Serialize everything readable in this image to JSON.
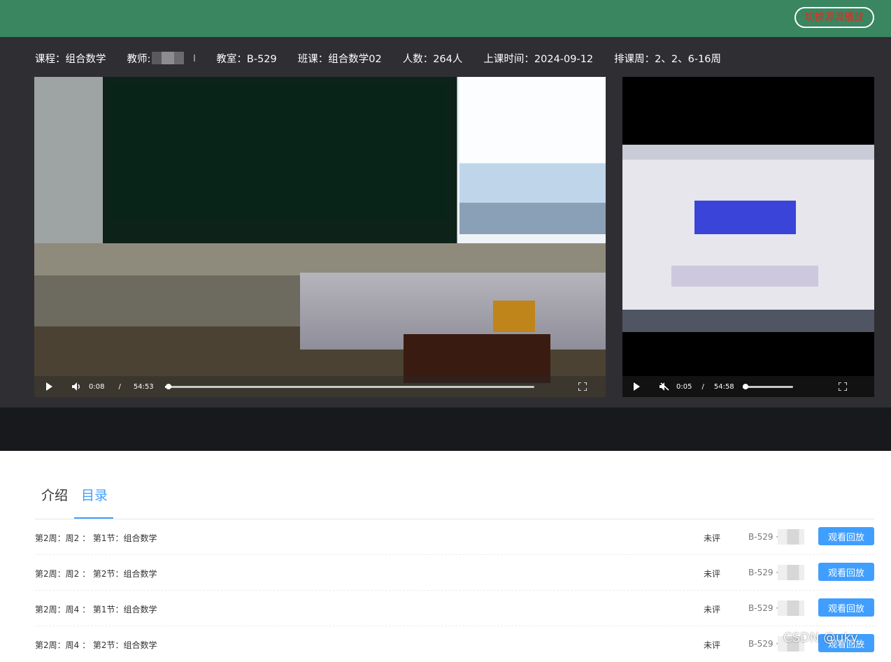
{
  "header": {
    "switch_button_label": "切换源流播放",
    "accent_color": "#3a8660"
  },
  "course_info": {
    "course": "课程：组合数学",
    "teacher_label": "教师:",
    "classroom": "教室：B-529",
    "class": "班课：组合数学02",
    "count": "人数：264人",
    "start_time": "上课时间：2024-09-12",
    "weeks": "排课周：2、2、6-16周"
  },
  "players": {
    "main": {
      "current_time": "0:08",
      "separator": "/",
      "duration": "54:53",
      "progress": 0.0024,
      "muted": false,
      "icons": [
        "play-icon",
        "volume-icon",
        "fullscreen-icon"
      ]
    },
    "side": {
      "current_time": "0:05",
      "separator": "/",
      "duration": "54:58",
      "progress": 0.0015,
      "muted": true,
      "icons": [
        "play-icon",
        "volume-muted-icon",
        "fullscreen-icon"
      ]
    }
  },
  "tabs": [
    {
      "label": "介绍",
      "active": false
    },
    {
      "label": "目录",
      "active": true
    }
  ],
  "lessons": [
    {
      "title": "第2周：周2 ： 第1节：组合数学",
      "rating": "未评",
      "room": "B-529 ·",
      "button": "观看回放"
    },
    {
      "title": "第2周：周2 ： 第2节：组合数学",
      "rating": "未评",
      "room": "B-529 ·",
      "button": "观看回放"
    },
    {
      "title": "第2周：周4 ： 第1节：组合数学",
      "rating": "未评",
      "room": "B-529 ·",
      "button": "观看回放"
    },
    {
      "title": "第2周：周4 ： 第2节：组合数学",
      "rating": "未评",
      "room": "B-529 ·",
      "button": "观看回放"
    }
  ],
  "watermark": "CSDN @uky_",
  "colors": {
    "link_blue": "#409eff",
    "alert_red": "#e02b20",
    "player_bg": "#2f2e33"
  }
}
